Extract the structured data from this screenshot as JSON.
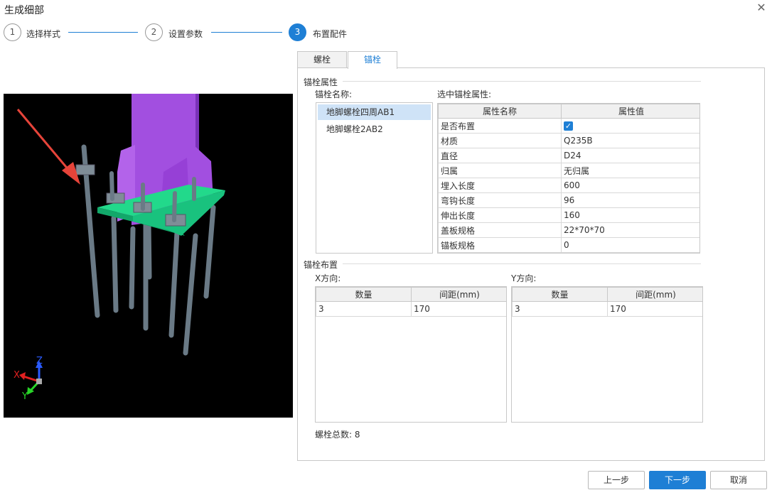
{
  "dialog": {
    "title": "生成细部"
  },
  "steps": [
    {
      "number": "1",
      "label": "选择样式"
    },
    {
      "number": "2",
      "label": "设置参数"
    },
    {
      "number": "3",
      "label": "布置配件"
    }
  ],
  "tabs": [
    {
      "label": "螺栓"
    },
    {
      "label": "锚栓"
    }
  ],
  "anchor_properties": {
    "group_title": "锚栓属性",
    "name_label": "锚栓名称:",
    "names": [
      "地脚螺栓四周AB1",
      "地脚螺栓2AB2"
    ],
    "selected_label": "选中锚栓属性:",
    "columns": [
      "属性名称",
      "属性值"
    ],
    "rows": [
      {
        "name": "是否布置",
        "value": "",
        "checked": true
      },
      {
        "name": "材质",
        "value": "Q235B"
      },
      {
        "name": "直径",
        "value": "D24"
      },
      {
        "name": "归属",
        "value": "无归属"
      },
      {
        "name": "埋入长度",
        "value": "600"
      },
      {
        "name": "弯钩长度",
        "value": "96"
      },
      {
        "name": "伸出长度",
        "value": "160"
      },
      {
        "name": "盖板规格",
        "value": "22*70*70"
      },
      {
        "name": "锚板规格",
        "value": "0"
      }
    ]
  },
  "layout_group": {
    "group_title": "锚栓布置",
    "x": {
      "label": "X方向:",
      "columns": [
        "数量",
        "间距(mm)"
      ],
      "rows": [
        [
          "3",
          "170"
        ]
      ]
    },
    "y": {
      "label": "Y方向:",
      "columns": [
        "数量",
        "间距(mm)"
      ],
      "rows": [
        [
          "3",
          "170"
        ]
      ]
    }
  },
  "total": {
    "label": "螺栓总数:",
    "value": "8"
  },
  "viewport": {
    "axis_labels": {
      "x": "X",
      "y": "Y",
      "z": "Z"
    }
  },
  "buttons": {
    "prev": "上一步",
    "next": "下一步",
    "cancel": "取消"
  },
  "colors": {
    "accent": "#1e7fd5",
    "column": "#a24fe0",
    "plate": "#19c27e",
    "bolt": "#6a7a86"
  }
}
